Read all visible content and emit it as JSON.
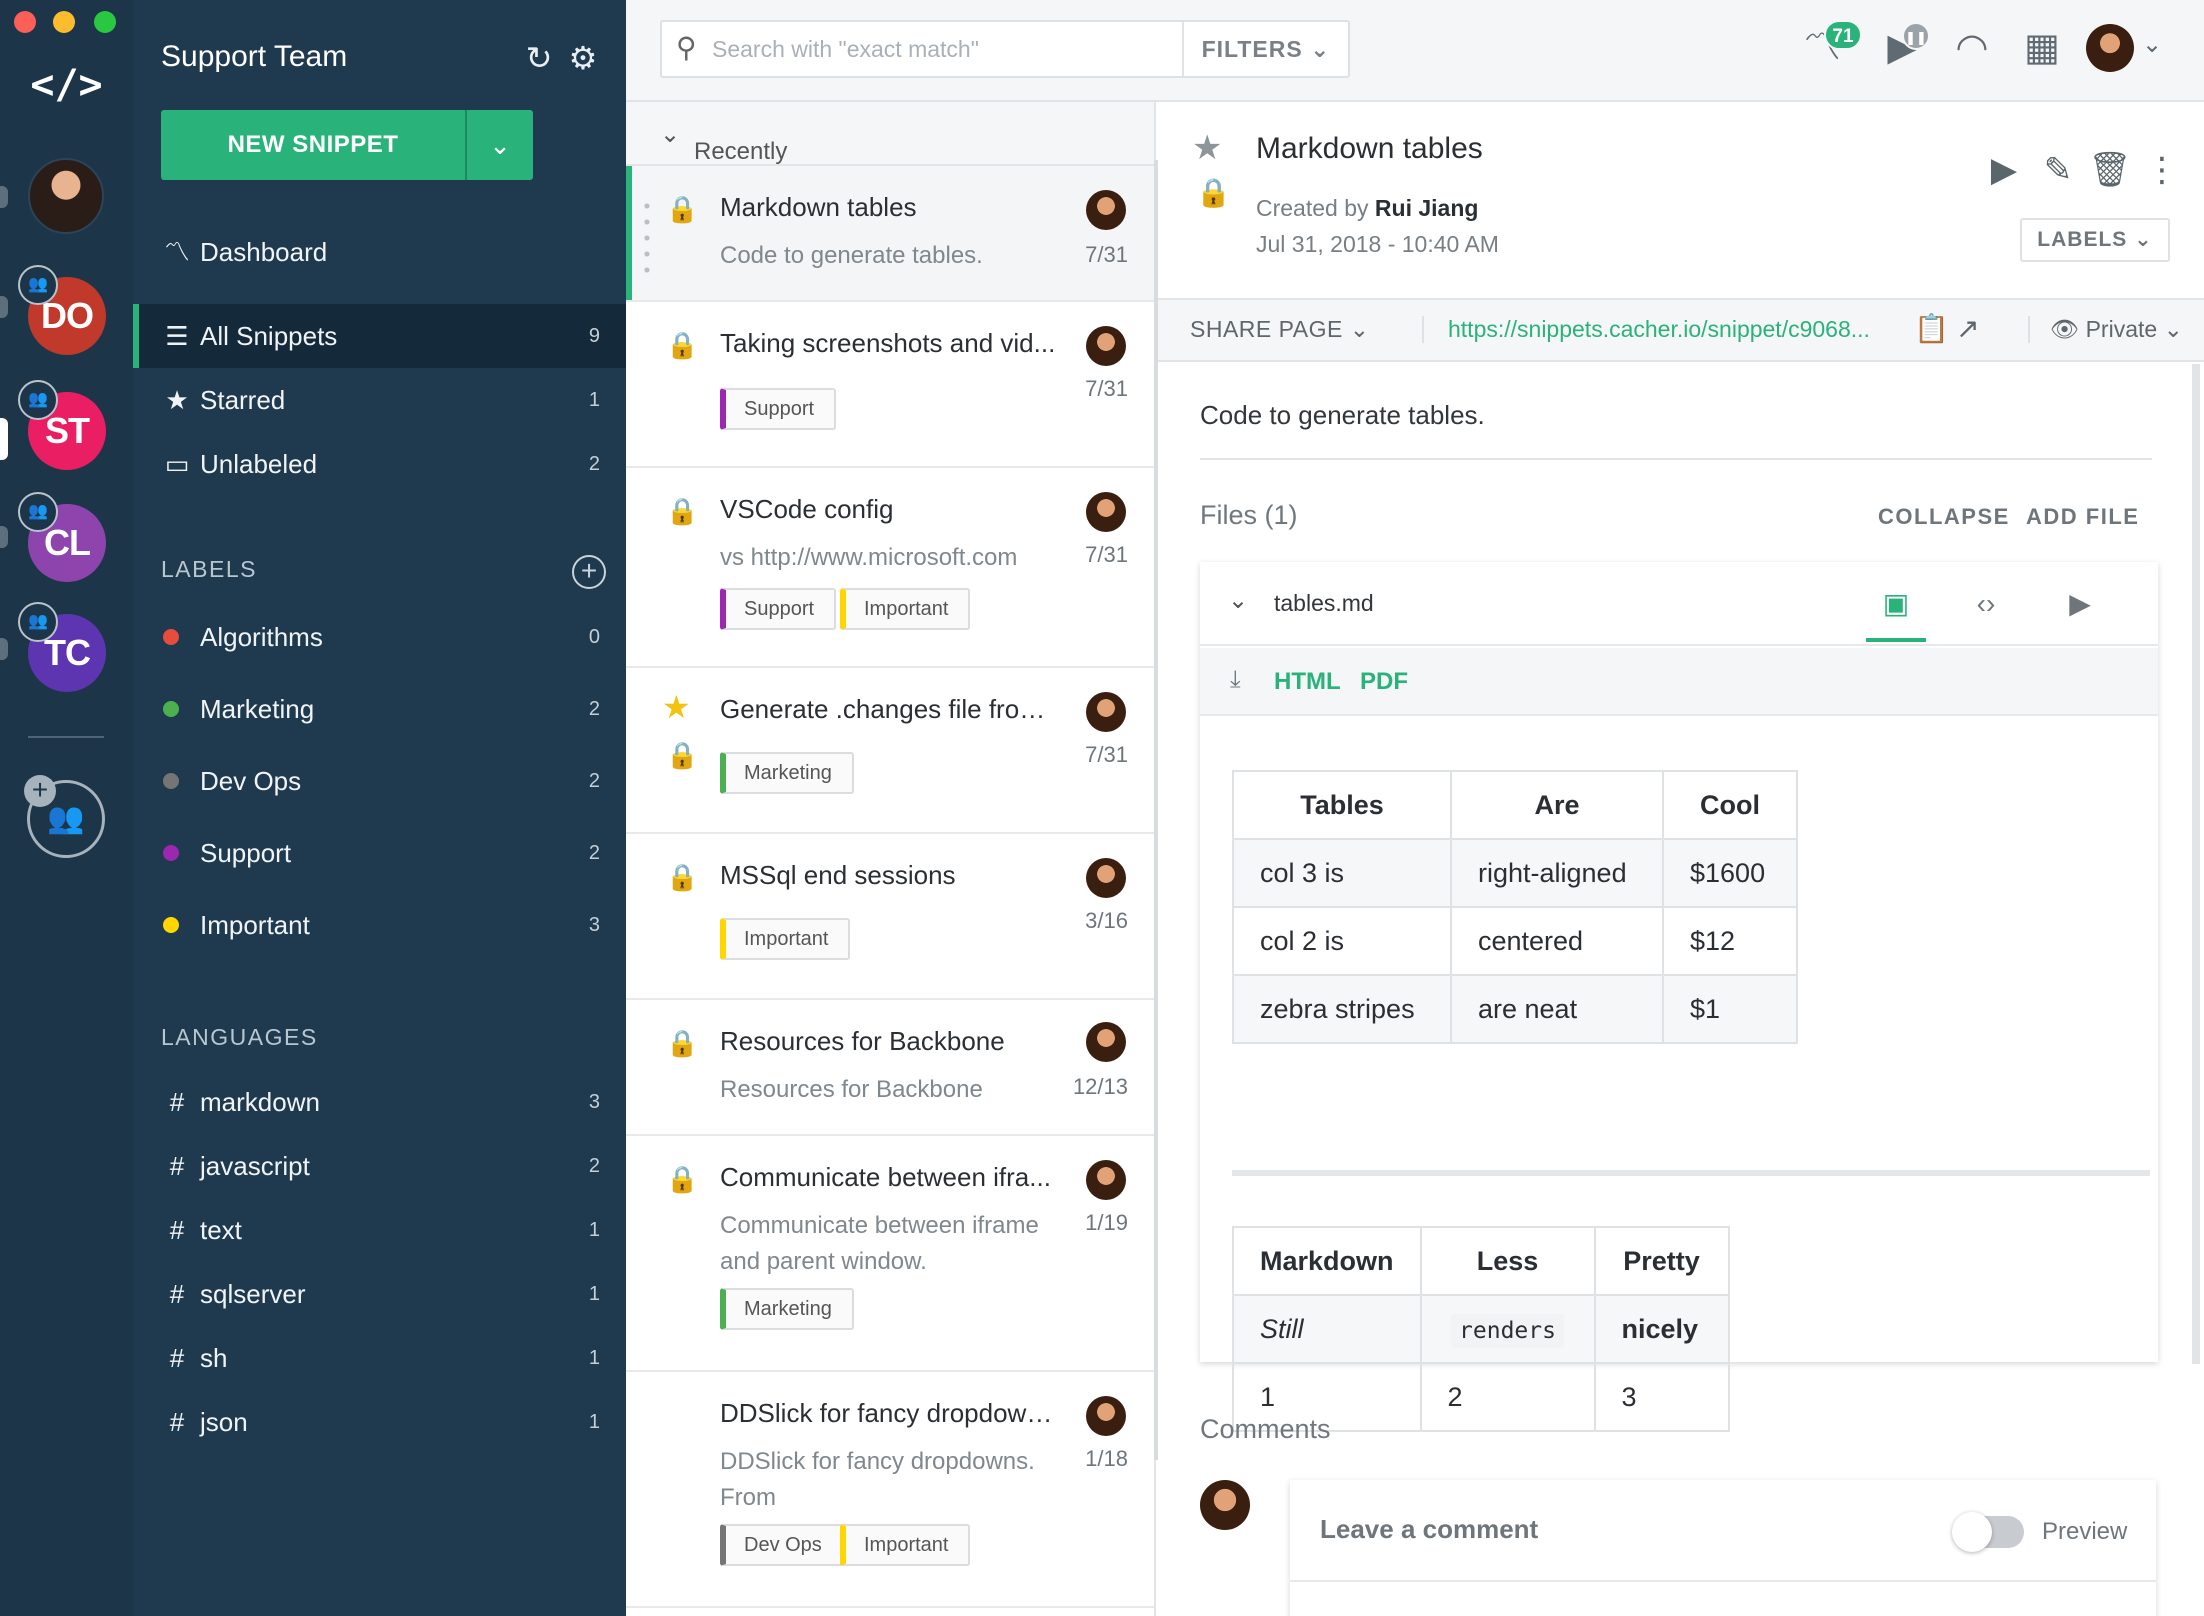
{
  "rail": {
    "logo": "</>",
    "teams": [
      {
        "initials": "DO",
        "color": "#c0392b"
      },
      {
        "initials": "ST",
        "color": "#e91e63"
      },
      {
        "initials": "CL",
        "color": "#8e44ad"
      },
      {
        "initials": "TC",
        "color": "#5e35b1"
      }
    ]
  },
  "sidebar": {
    "team_name": "Support Team",
    "new_snippet": "NEW SNIPPET",
    "dashboard": "Dashboard",
    "nav": [
      {
        "label": "All Snippets",
        "count": "9",
        "icon": "list-icon"
      },
      {
        "label": "Starred",
        "count": "1",
        "icon": "star-icon"
      },
      {
        "label": "Unlabeled",
        "count": "2",
        "icon": "label-outline-icon"
      }
    ],
    "labels_title": "LABELS",
    "labels": [
      {
        "label": "Algorithms",
        "count": "0",
        "color": "#e74c3c"
      },
      {
        "label": "Marketing",
        "count": "2",
        "color": "#4caf50"
      },
      {
        "label": "Dev Ops",
        "count": "2",
        "color": "#757575"
      },
      {
        "label": "Support",
        "count": "2",
        "color": "#9c27b0"
      },
      {
        "label": "Important",
        "count": "3",
        "color": "#ffd600"
      }
    ],
    "languages_title": "LANGUAGES",
    "languages": [
      {
        "label": "markdown",
        "count": "3"
      },
      {
        "label": "javascript",
        "count": "2"
      },
      {
        "label": "text",
        "count": "1"
      },
      {
        "label": "sqlserver",
        "count": "1"
      },
      {
        "label": "sh",
        "count": "1"
      },
      {
        "label": "json",
        "count": "1"
      }
    ]
  },
  "topbar": {
    "search_placeholder": "Search with \"exact match\"",
    "filters": "FILTERS",
    "notification_count": "71"
  },
  "list": {
    "sort_label": "Recently created",
    "snippets": [
      {
        "title": "Markdown tables",
        "desc": "Code to generate tables.",
        "date": "7/31",
        "tags": []
      },
      {
        "title": "Taking screenshots and vid...",
        "desc": "",
        "date": "7/31",
        "tags": [
          "Support"
        ]
      },
      {
        "title": "VSCode config",
        "desc": "vs http://www.microsoft.com",
        "date": "7/31",
        "tags": [
          "Support",
          "Important"
        ]
      },
      {
        "title": "Generate .changes file from...",
        "desc": "",
        "date": "7/31",
        "tags": [
          "Marketing"
        ]
      },
      {
        "title": "MSSql end sessions",
        "desc": "",
        "date": "3/16",
        "tags": [
          "Important"
        ]
      },
      {
        "title": "Resources for Backbone",
        "desc": "Resources for Backbone",
        "date": "12/13",
        "tags": []
      },
      {
        "title": "Communicate between ifra...",
        "desc": "Communicate between iframe and parent window.",
        "date": "1/19",
        "tags": [
          "Marketing"
        ]
      },
      {
        "title": "DDSlick for fancy dropdown...",
        "desc": "DDSlick for fancy dropdowns. From",
        "date": "1/18",
        "tags": [
          "Dev Ops",
          "Important"
        ]
      }
    ],
    "tag_colors": {
      "Support": "#9c27b0",
      "Important": "#ffd600",
      "Marketing": "#4caf50",
      "Dev Ops": "#757575"
    }
  },
  "detail": {
    "title": "Markdown tables",
    "created_by_prefix": "Created by",
    "author": "Rui Jiang",
    "created_at": "Jul 31, 2018 - 10:40 AM",
    "labels_btn": "LABELS",
    "share_page": "SHARE PAGE",
    "share_url": "https://snippets.cacher.io/snippet/c9068...",
    "privacy": "Private",
    "description": "Code to generate tables.",
    "files_heading": "Files (1)",
    "collapse": "COLLAPSE",
    "add_file": "ADD FILE",
    "file_name": "tables.md",
    "export_html": "HTML",
    "export_pdf": "PDF",
    "table1": {
      "headers": [
        "Tables",
        "Are",
        "Cool"
      ],
      "rows": [
        [
          "col 3 is",
          "right-aligned",
          "$1600"
        ],
        [
          "col 2 is",
          "centered",
          "$12"
        ],
        [
          "zebra stripes",
          "are neat",
          "$1"
        ]
      ]
    },
    "table2": {
      "headers": [
        "Markdown",
        "Less",
        "Pretty"
      ],
      "rows": [
        [
          "Still",
          "renders",
          "nicely"
        ],
        [
          "1",
          "2",
          "3"
        ]
      ]
    },
    "comments_heading": "Comments",
    "comment_placeholder": "Leave a comment",
    "preview_label": "Preview"
  }
}
